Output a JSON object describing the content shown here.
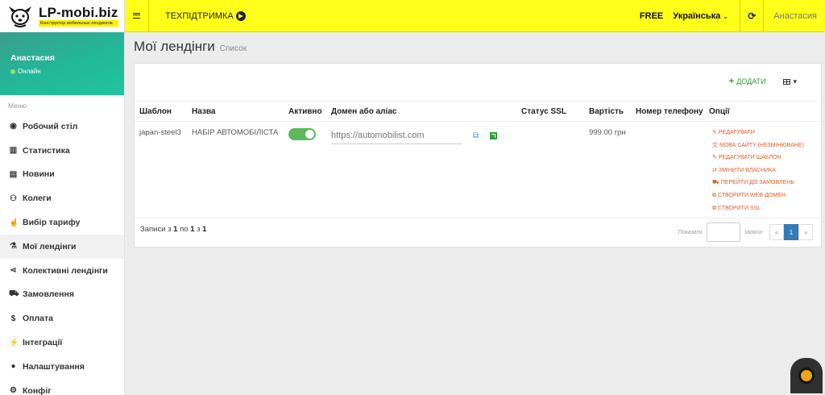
{
  "header": {
    "logo_name": "LP-mobi.biz",
    "logo_subtitle": "Конструктор мобильных лендингов",
    "support_label": "ТЕХПІДТРИМКА",
    "plan": "FREE",
    "language": "Українська",
    "user": "Анастасия"
  },
  "sidebar": {
    "user_name": "Анастасия",
    "user_status": "Онлайн",
    "menu_header": "Меню",
    "items": [
      {
        "label": "Робочий стіл",
        "icon": "dashboard-icon"
      },
      {
        "label": "Статистика",
        "icon": "bar-chart-icon"
      },
      {
        "label": "Новини",
        "icon": "newspaper-icon"
      },
      {
        "label": "Колеги",
        "icon": "users-icon"
      },
      {
        "label": "Вибір тарифу",
        "icon": "hand-pointer-icon"
      },
      {
        "label": "Мої лендінги",
        "icon": "flask-icon"
      },
      {
        "label": "Колективні лендінги",
        "icon": "share-icon"
      },
      {
        "label": "Замовлення",
        "icon": "cart-icon"
      },
      {
        "label": "Оплата",
        "icon": "dollar-icon"
      },
      {
        "label": "Інтеграції",
        "icon": "plug-icon"
      },
      {
        "label": "Налаштування",
        "icon": "user-icon"
      },
      {
        "label": "Конфіг",
        "icon": "cogs-icon"
      }
    ]
  },
  "page": {
    "title": "Мої лендінги",
    "subtitle": "Список"
  },
  "toolbar": {
    "add_label": "ДОДАТИ"
  },
  "table": {
    "headers": [
      "Шаблон",
      "Назва",
      "Активно",
      "Домен або аліас",
      "Статус SSL",
      "Вартість",
      "Номер телефону",
      "Опції"
    ],
    "rows": [
      {
        "template": "japan-steel3",
        "name": "НАБІР АВТОМОБІЛІСТА",
        "active": true,
        "domain_placeholder": "https://automobilist.com",
        "ssl": "",
        "price": "999.00 грн",
        "phone": "",
        "options": [
          "РЕДАГУВАТИ",
          "МОВА САЙТУ (НЕЗМІНЮВАНЕ)",
          "РЕДАГУВАТИ ШАБЛОН",
          "ЗМІНИТИ ВЛАСНИКА",
          "ПЕРЕЙТИ ДО ЗАМОВЛЕНЬ",
          "СТВОРИТИ WEB-ДОМЕН",
          "СТВОРИТИ SSL"
        ]
      }
    ]
  },
  "footer": {
    "prefix": "Записи з ",
    "from": "1",
    "mid": " по ",
    "to": "1",
    "of": " з ",
    "total": "1",
    "show_label": "Показати",
    "records_label": "записи",
    "prev": "«",
    "current_page": "1",
    "next": "»"
  },
  "colors": {
    "topbar": "#ffff1a",
    "accent_green": "#2e9d3a",
    "option_red": "#e05a2a",
    "teal": "#22b89a"
  }
}
